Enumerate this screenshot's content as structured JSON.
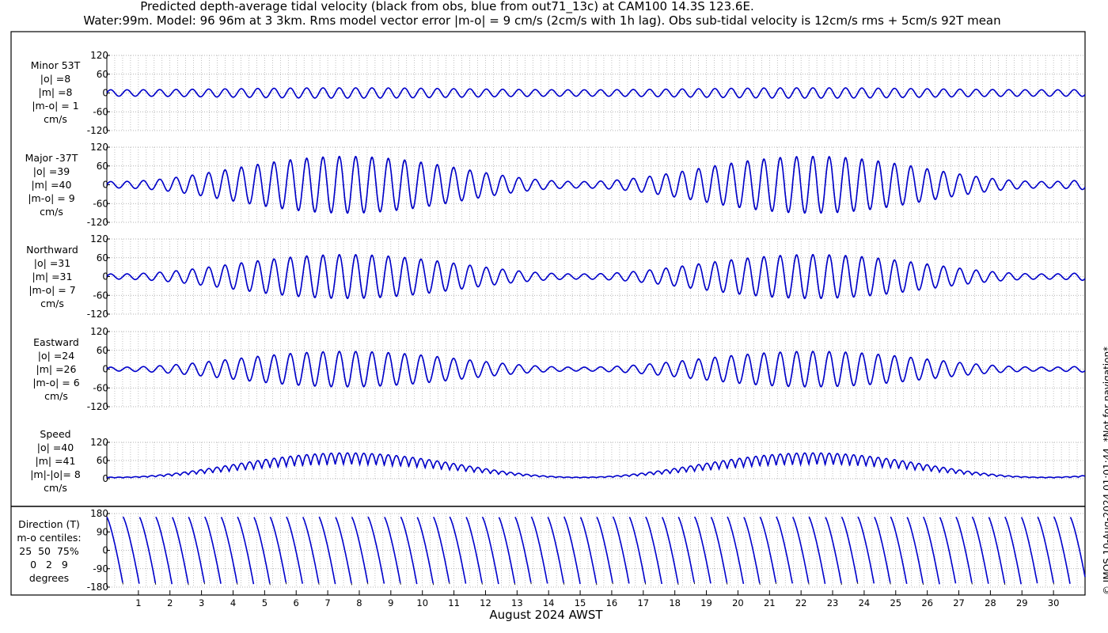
{
  "header": {
    "title_line1": "Predicted depth-average tidal velocity (black from obs, blue from out71_13c) at CAM100 14.3S 123.6E.",
    "title_line2": "Water:99m. Model: 96 96m at 3 3km. Rms model vector error |m-o| = 9 cm/s (2cm/s with 1h lag). Obs sub-tidal velocity is 12cm/s rms + 5cm/s 92T mean"
  },
  "copyright": "© IMOS 10-Aug-2024 01:01:44. *Not for navigation*",
  "xaxis": {
    "label": "August 2024 AWST",
    "ticks": [
      "1",
      "2",
      "3",
      "4",
      "5",
      "6",
      "7",
      "8",
      "9",
      "10",
      "11",
      "12",
      "13",
      "14",
      "15",
      "16",
      "17",
      "18",
      "19",
      "20",
      "21",
      "22",
      "23",
      "24",
      "25",
      "26",
      "27",
      "28",
      "29",
      "30"
    ]
  },
  "colors": {
    "obs": "#000000",
    "model": "#0000cc",
    "grid": "#9a9a9a"
  },
  "panels": [
    {
      "id": "minor",
      "label": [
        "Minor 53T",
        "|o| =8",
        "|m| =8",
        "|m-o| = 1",
        "cm/s"
      ]
    },
    {
      "id": "major",
      "label": [
        "Major -37T",
        "|o| =39",
        "|m| =40",
        "|m-o| = 9",
        "cm/s"
      ]
    },
    {
      "id": "north",
      "label": [
        "Northward",
        "|o| =31",
        "|m| =31",
        "|m-o| = 7",
        "cm/s"
      ]
    },
    {
      "id": "east",
      "label": [
        "Eastward",
        "|o| =24",
        "|m| =26",
        "|m-o| = 6",
        "cm/s"
      ]
    },
    {
      "id": "speed",
      "label": [
        "Speed",
        "|o| =40",
        "|m| =41",
        "|m|-|o|= 8",
        "cm/s"
      ]
    },
    {
      "id": "dir",
      "label": [
        "Direction (T)",
        "m-o centiles:",
        "25  50  75%",
        "0   2   9",
        "degrees"
      ]
    }
  ],
  "chart_data": [
    {
      "type": "line",
      "title": "Minor 53T",
      "ylabel": "cm/s",
      "ylim": [
        -120,
        120
      ],
      "yticks": [
        "120",
        "60",
        "0",
        "-60",
        "-120"
      ],
      "xlim": [
        0,
        31
      ],
      "grid": true,
      "amplitude_env": [
        8,
        18
      ],
      "series": [
        {
          "name": "obs"
        },
        {
          "name": "model"
        }
      ]
    },
    {
      "type": "line",
      "title": "Major -37T",
      "ylabel": "cm/s",
      "ylim": [
        -120,
        120
      ],
      "yticks": [
        "120",
        "60",
        "0",
        "-60",
        "-120"
      ],
      "xlim": [
        0,
        31
      ],
      "grid": true,
      "amplitude_env": [
        10,
        88
      ],
      "series": [
        {
          "name": "obs"
        },
        {
          "name": "model"
        }
      ]
    },
    {
      "type": "line",
      "title": "Northward",
      "ylabel": "cm/s",
      "ylim": [
        -120,
        120
      ],
      "yticks": [
        "120",
        "60",
        "0",
        "-60",
        "-120"
      ],
      "xlim": [
        0,
        31
      ],
      "grid": true,
      "amplitude_env": [
        8,
        68
      ],
      "series": [
        {
          "name": "obs"
        },
        {
          "name": "model"
        }
      ]
    },
    {
      "type": "line",
      "title": "Eastward",
      "ylabel": "cm/s",
      "ylim": [
        -120,
        120
      ],
      "yticks": [
        "120",
        "60",
        "0",
        "-60",
        "-120"
      ],
      "xlim": [
        0,
        31
      ],
      "grid": true,
      "amplitude_env": [
        6,
        55
      ],
      "series": [
        {
          "name": "obs"
        },
        {
          "name": "model"
        }
      ]
    },
    {
      "type": "line",
      "title": "Speed",
      "ylabel": "cm/s",
      "ylim": [
        0,
        120
      ],
      "yticks": [
        "120",
        "60",
        "0"
      ],
      "xlim": [
        0,
        31
      ],
      "grid": true,
      "amplitude_env": [
        5,
        85
      ],
      "series": [
        {
          "name": "obs"
        },
        {
          "name": "model"
        }
      ]
    },
    {
      "type": "line",
      "title": "Direction (T)",
      "ylabel": "degrees",
      "ylim": [
        -180,
        180
      ],
      "yticks": [
        "180",
        "90",
        "0",
        "-90",
        "-180"
      ],
      "xlim": [
        0,
        31
      ],
      "grid": true,
      "series": [
        {
          "name": "obs"
        },
        {
          "name": "model"
        }
      ]
    }
  ]
}
